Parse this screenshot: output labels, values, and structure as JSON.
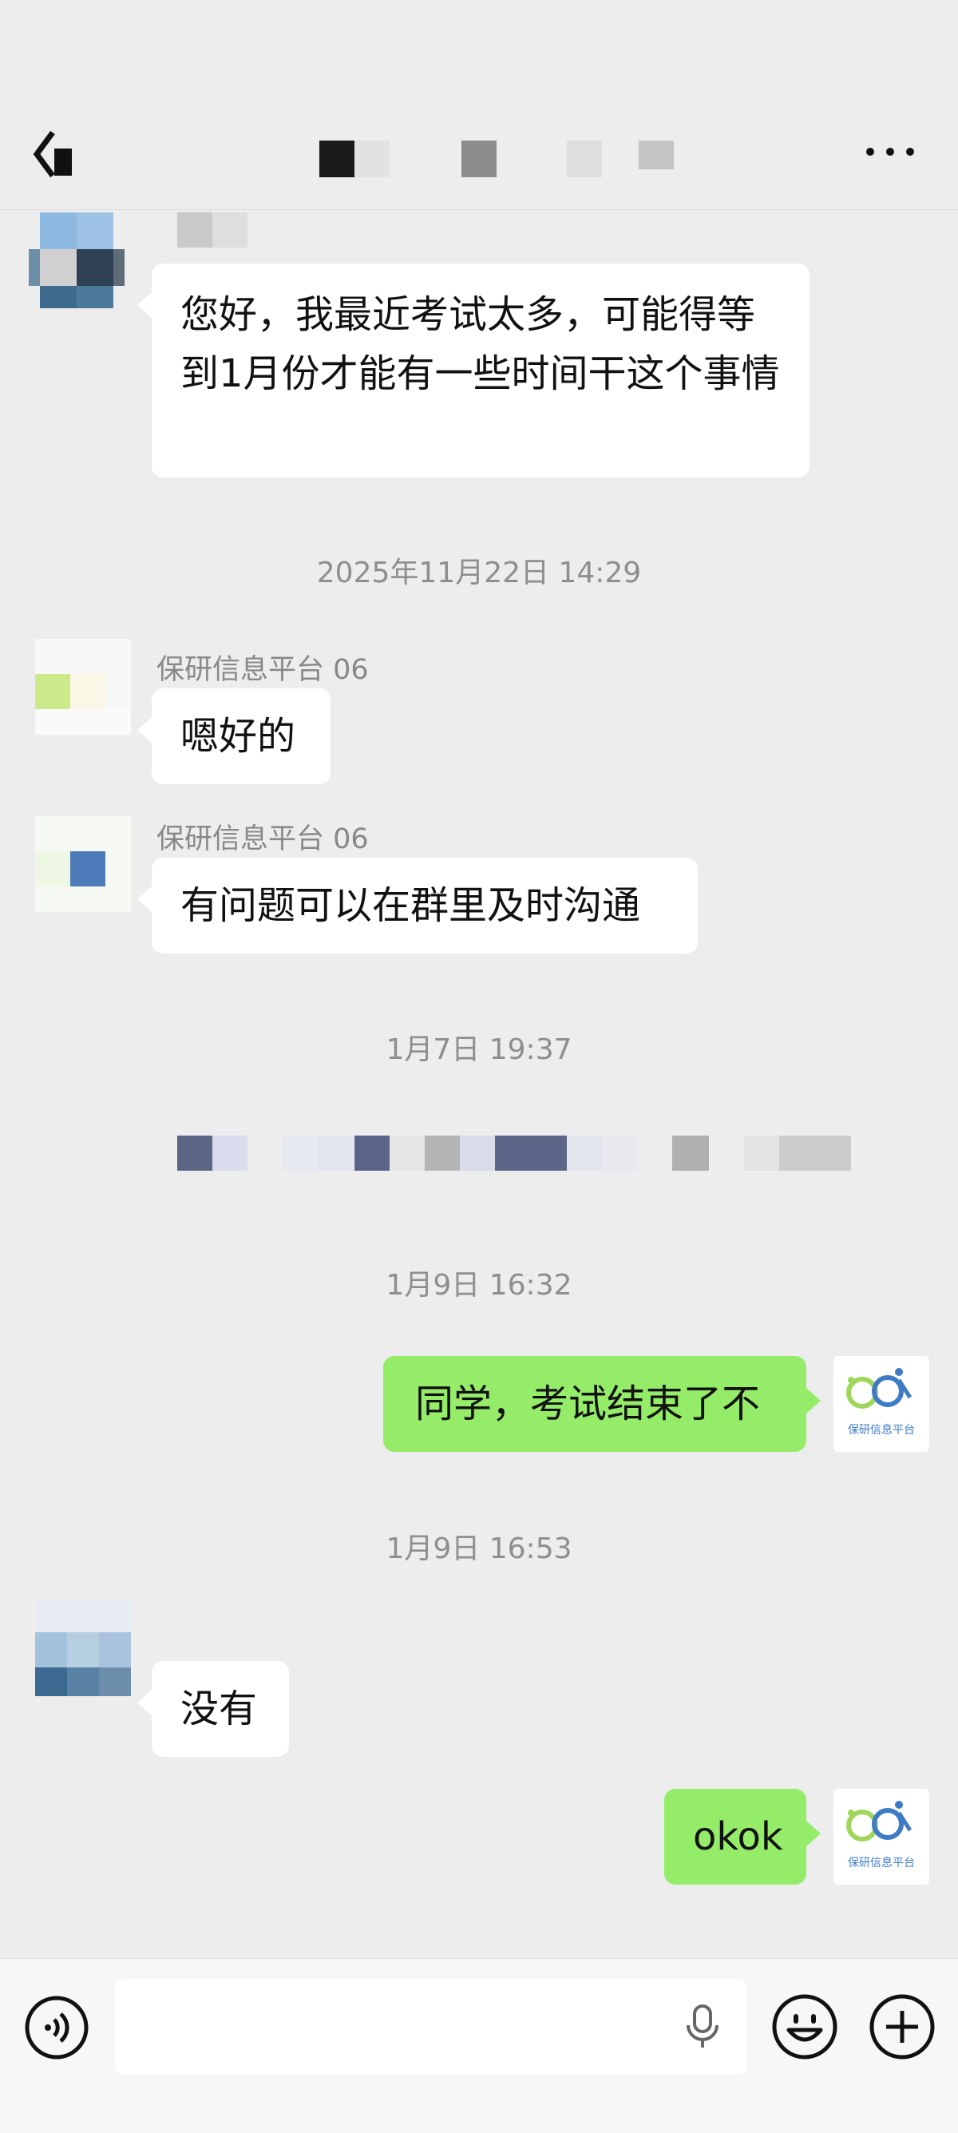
{
  "messages": {
    "m1_text": "您好，我最近考试太多，可能得等到1月份才能有一些时间干这个事情",
    "t1": "2025年11月22日 14:29",
    "m2_sender": "保研信息平台 06",
    "m2_text": "嗯好的",
    "m3_sender": "保研信息平台 06",
    "m3_text": "有问题可以在群里及时沟通",
    "t2": "1月7日 19:37",
    "t3": "1月9日 16:32",
    "m4_text": "同学，考试结束了不",
    "t4": "1月9日 16:53",
    "m5_text": "没有",
    "m6_text": "okok"
  },
  "self_avatar": {
    "caption": "保研信息平台"
  },
  "colors": {
    "background": "#ededed",
    "incoming_bubble": "#ffffff",
    "outgoing_bubble": "#95ec69"
  },
  "icons": [
    "back-icon",
    "more-icon",
    "voice-icon",
    "mic-icon",
    "emoji-icon",
    "plus-icon"
  ]
}
